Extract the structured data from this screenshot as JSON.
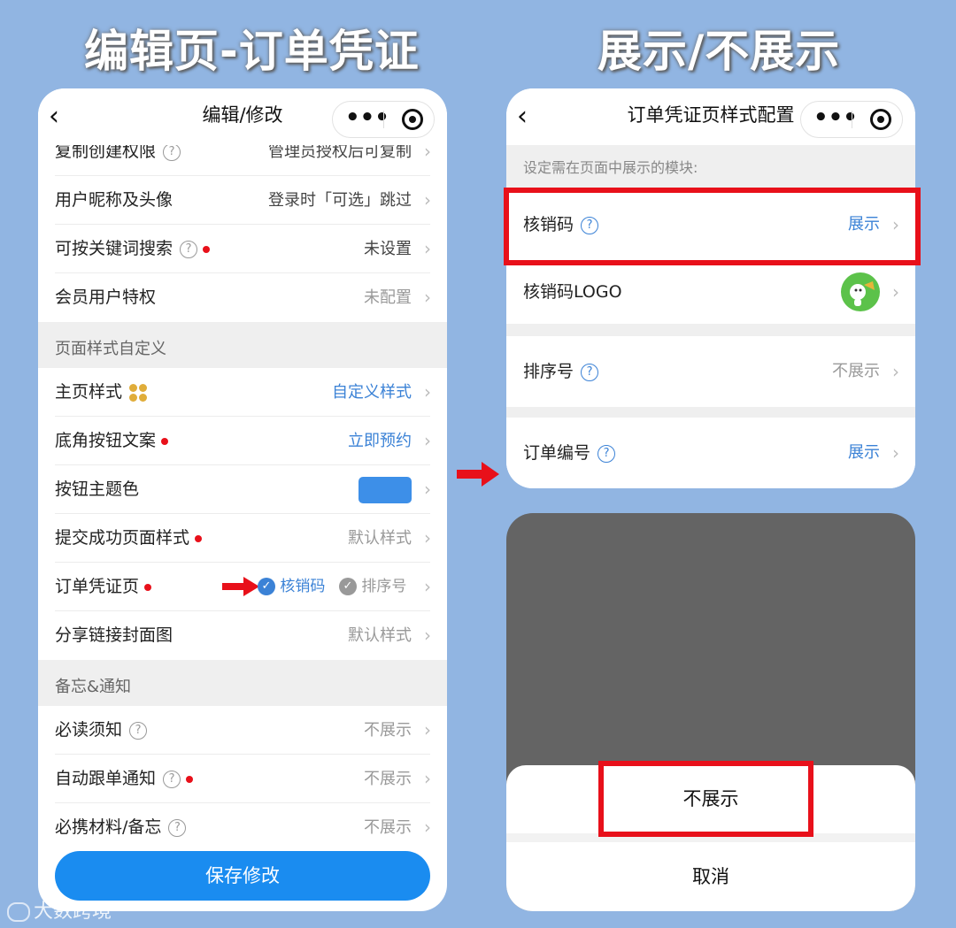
{
  "headings": {
    "left": "编辑页-订单凭证",
    "right": "展示/不展示"
  },
  "left_phone": {
    "nav": {
      "back": "‹",
      "title": "编辑/修改",
      "more": "•••"
    },
    "rows_top": [
      {
        "label": "复制创建权限",
        "value": "管理员授权后可复制"
      },
      {
        "label": "用户昵称及头像",
        "value": "登录时「可选」跳过"
      },
      {
        "label": "可按关键词搜索",
        "value": "未设置"
      },
      {
        "label": "会员用户特权",
        "value": "未配置"
      }
    ],
    "section_style": "页面样式自定义",
    "rows_style": [
      {
        "label": "主页样式",
        "value": "自定义样式"
      },
      {
        "label": "底角按钮文案",
        "value": "立即预约"
      },
      {
        "label": "按钮主题色",
        "value": ""
      },
      {
        "label": "提交成功页面样式",
        "value": "默认样式"
      },
      {
        "label": "订单凭证页",
        "check1": "核销码",
        "check2": "排序号"
      },
      {
        "label": "分享链接封面图",
        "value": "默认样式"
      }
    ],
    "section_notice": "备忘&通知",
    "rows_notice": [
      {
        "label": "必读须知",
        "value": "不展示"
      },
      {
        "label": "自动跟单通知",
        "value": "不展示"
      },
      {
        "label": "必携材料/备忘",
        "value": "不展示"
      }
    ],
    "save_label": "保存修改",
    "theme_color": "#3d8fe8"
  },
  "right_phone": {
    "nav": {
      "back": "‹",
      "title": "订单凭证页样式配置",
      "more": "•••"
    },
    "hint": "设定需在页面中展示的模块:",
    "rows": [
      {
        "label": "核销码",
        "value": "展示"
      },
      {
        "label": "核销码LOGO",
        "value": ""
      },
      {
        "label": "排序号",
        "value": "不展示"
      },
      {
        "label": "订单编号",
        "value": "展示"
      }
    ]
  },
  "action_sheet": {
    "option": "不展示",
    "cancel": "取消"
  },
  "watermark": "大数跨境",
  "colors": {
    "accent": "#1a8cf0",
    "highlight": "#e8101a",
    "background": "#91b5e2"
  }
}
